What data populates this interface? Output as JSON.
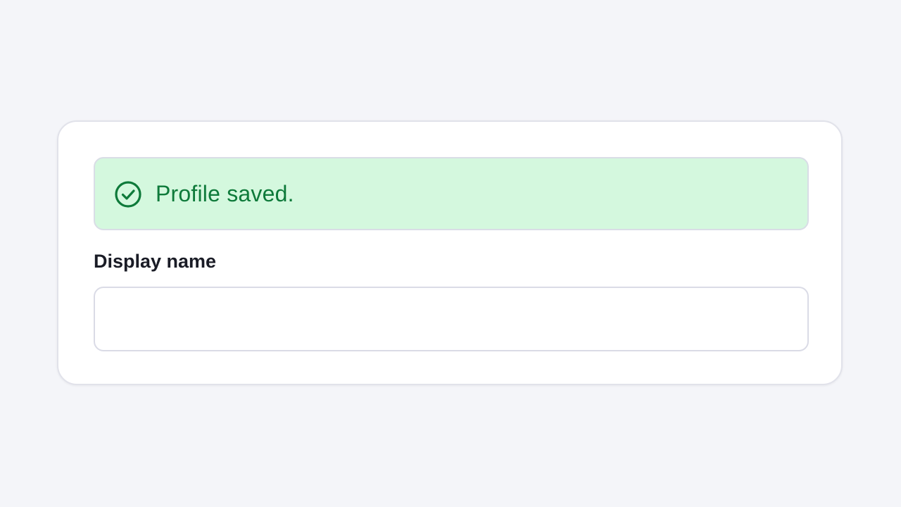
{
  "toast": {
    "message": "Profile saved.",
    "icon": "check-circle-icon",
    "color": "#0e7a3a",
    "background": "#d4f8de"
  },
  "form": {
    "display_name": {
      "label": "Display name",
      "value": "",
      "placeholder": ""
    }
  }
}
